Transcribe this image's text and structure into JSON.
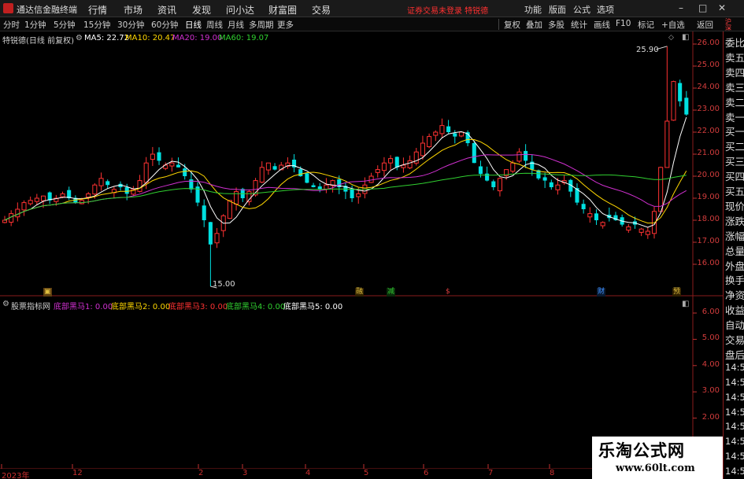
{
  "app": {
    "title": "通达信金融终端",
    "menu": [
      "行情",
      "市场",
      "资讯",
      "发现",
      "问小达",
      "财富圈",
      "交易"
    ],
    "status_alert": "证券交易未登录 特锐德",
    "right_menu": [
      "功能",
      "版面",
      "公式",
      "选项"
    ],
    "window_controls": [
      "–",
      "□",
      "✕"
    ]
  },
  "timeframes": [
    "分时",
    "1分钟",
    "5分钟",
    "15分钟",
    "30分钟",
    "60分钟",
    "日线",
    "周线",
    "月线",
    "多周期",
    "更多"
  ],
  "active_timeframe": "日线",
  "chart_tools": [
    "复权",
    "叠加",
    "多股",
    "统计",
    "画线",
    "F10",
    "标记",
    "+自选",
    "返回"
  ],
  "main_chart": {
    "stock_label": "特锐德(日线 前复权)",
    "ma5_label": "MA5: 22.72",
    "ma10_label": "MA10: 20.47",
    "ma20_label": "MA20: 19.00",
    "ma60_label": "MA60: 19.07",
    "high_marker": "25.90",
    "low_marker": "15.00",
    "price_ticks": [
      "26.00",
      "25.00",
      "24.00",
      "23.00",
      "22.00",
      "21.00",
      "20.00",
      "19.00",
      "18.00",
      "17.00",
      "16.00"
    ]
  },
  "colors": {
    "up": "#ff3232",
    "down": "#00e0e0",
    "ma5": "#ffffff",
    "ma10": "#ffd700",
    "ma20": "#d030d0",
    "ma60": "#30d030",
    "axis": "#c03030"
  },
  "right_panel": [
    "委比",
    "卖五",
    "卖四",
    "卖三",
    "卖二",
    "卖一",
    "买一",
    "买二",
    "买三",
    "买四",
    "买五",
    "现价",
    "涨跌",
    "涨幅",
    "总量",
    "外盘",
    "换手",
    "净资",
    "收益",
    "自动",
    "交易",
    "盘后",
    "14:5",
    "14:5",
    "14:5",
    "14:5",
    "14:5",
    "14:5",
    "14:5",
    "14:5"
  ],
  "event_markers": [
    {
      "label": "融",
      "color": "#e0c040"
    },
    {
      "label": "减",
      "color": "#30c030"
    },
    {
      "label": "$",
      "color": "#e04040"
    },
    {
      "label": "财",
      "color": "#4090ff"
    },
    {
      "label": "预",
      "color": "#e0c040"
    }
  ],
  "indicator": {
    "name": "股票指标网",
    "lines": [
      {
        "label": "底部黑马1: 0.00",
        "color": "#d030d0"
      },
      {
        "label": "底部黑马2: 0.00",
        "color": "#ffd700"
      },
      {
        "label": "底部黑马3: 0.00",
        "color": "#ff3232"
      },
      {
        "label": "底部黑马4: 0.00",
        "color": "#30d030"
      },
      {
        "label": "底部黑马5: 0.00",
        "color": "#ffffff"
      }
    ],
    "ticks": [
      "6.00",
      "5.00",
      "4.00",
      "3.00",
      "2.00",
      "1.00"
    ]
  },
  "x_axis": [
    "2023年",
    "12",
    "2",
    "3",
    "4",
    "5",
    "6",
    "7",
    "8"
  ],
  "watermark": {
    "title": "乐淘公式网",
    "url": "www.60lt.com"
  },
  "chart_data": {
    "type": "candlestick",
    "closes": [
      18.0,
      18.3,
      18.5,
      18.8,
      18.9,
      19.0,
      19.1,
      18.9,
      19.0,
      19.2,
      19.0,
      18.8,
      18.9,
      19.2,
      19.6,
      19.9,
      19.6,
      19.4,
      19.5,
      19.2,
      19.4,
      19.8,
      20.6,
      21.0,
      20.7,
      20.5,
      20.6,
      20.4,
      20.0,
      19.4,
      18.8,
      18.0,
      16.9,
      17.4,
      18.2,
      18.9,
      19.3,
      19.0,
      19.3,
      19.8,
      20.4,
      20.6,
      20.3,
      20.5,
      20.6,
      20.4,
      20.0,
      19.7,
      19.5,
      19.4,
      19.6,
      19.8,
      19.5,
      19.3,
      19.0,
      19.2,
      19.6,
      20.0,
      20.3,
      20.6,
      20.8,
      20.4,
      20.5,
      20.7,
      21.1,
      21.5,
      21.8,
      22.0,
      22.3,
      22.0,
      21.8,
      22.0,
      21.5,
      20.6,
      20.1,
      19.8,
      19.5,
      19.9,
      20.3,
      20.6,
      21.1,
      20.7,
      20.3,
      19.9,
      19.8,
      19.5,
      19.6,
      19.8,
      19.3,
      18.8,
      18.5,
      18.3,
      18.0,
      17.9,
      18.1,
      18.0,
      17.8,
      17.7,
      17.8,
      17.6,
      17.5,
      18.4,
      20.4,
      22.5,
      24.3,
      23.4,
      22.8
    ],
    "ylim": [
      15.6,
      26.4
    ],
    "series": [
      {
        "name": "MA5",
        "values": []
      },
      {
        "name": "MA10",
        "values": []
      },
      {
        "name": "MA20",
        "values": []
      },
      {
        "name": "MA60",
        "values": []
      }
    ]
  }
}
